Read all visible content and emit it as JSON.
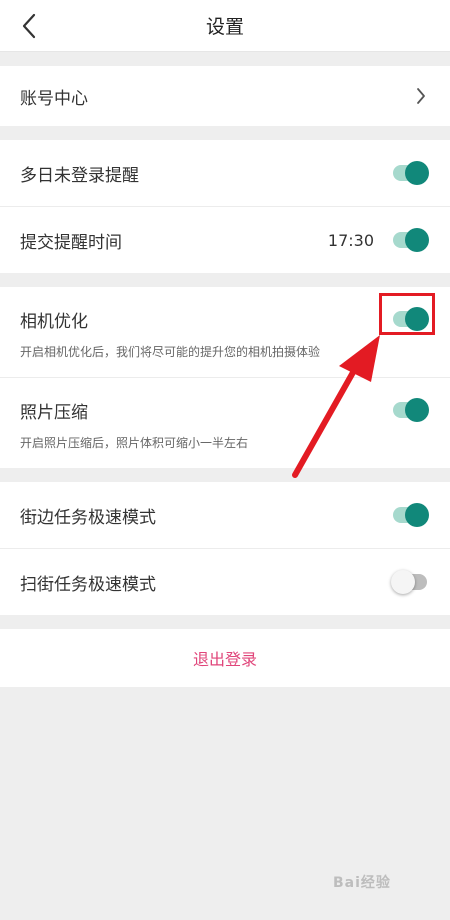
{
  "header": {
    "title": "设置",
    "back_icon": "chevron-left-icon"
  },
  "account": {
    "label": "账号中心",
    "icon": "chevron-right-icon"
  },
  "reminders": {
    "login_reminder": {
      "label": "多日未登录提醒",
      "enabled": true
    },
    "submit_reminder": {
      "label": "提交提醒时间",
      "time": "17:30",
      "enabled": true
    }
  },
  "camera": {
    "optimization": {
      "label": "相机优化",
      "desc": "开启相机优化后，我们将尽可能的提升您的相机拍摄体验",
      "enabled": true
    },
    "compression": {
      "label": "照片压缩",
      "desc": "开启照片压缩后，照片体积可缩小一半左右",
      "enabled": true
    }
  },
  "tasks": {
    "street_fast": {
      "label": "街边任务极速模式",
      "enabled": true
    },
    "sweep_fast": {
      "label": "扫街任务极速模式",
      "enabled": false
    }
  },
  "logout": {
    "label": "退出登录"
  },
  "watermark": "Bai经验",
  "colors": {
    "accent": "#11887a",
    "track_on": "#a6d9cd",
    "logout": "#e0457a",
    "annotation": "#e31b23"
  }
}
